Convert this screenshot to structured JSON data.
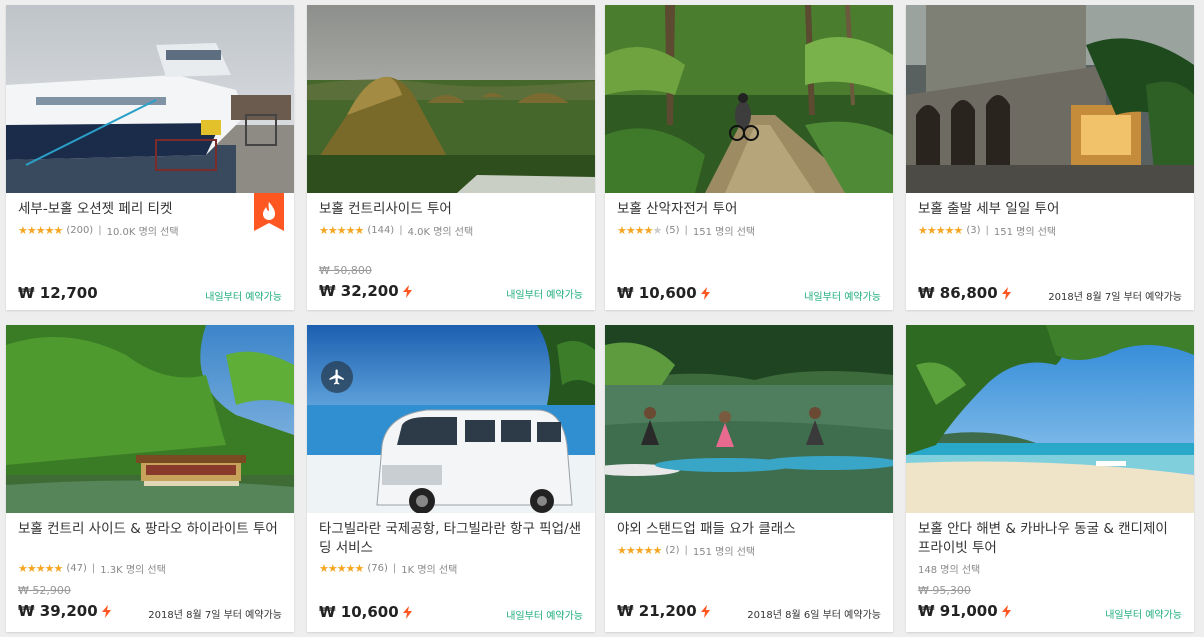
{
  "currency_symbol": "₩",
  "accent_color": "#ff5722",
  "avail_color": "#1fad7e",
  "cards": [
    {
      "title": "세부-보홀 오션젯 페리 티켓",
      "stars": 5,
      "reviews": "(200)",
      "chosen": "10.0K 명의 선택",
      "old_price": "",
      "price": "₩ 12,700",
      "instant": false,
      "avail": "내일부터 예약가능",
      "hot": true
    },
    {
      "title": "보홀 컨트리사이드 투어",
      "stars": 5,
      "reviews": "(144)",
      "chosen": "4.0K 명의 선택",
      "old_price": "₩ 50,800",
      "price": "₩ 32,200",
      "instant": true,
      "avail": "내일부터 예약가능"
    },
    {
      "title": "보홀 산악자전거 투어",
      "stars": 4,
      "reviews": "(5)",
      "chosen": "151 명의 선택",
      "old_price": "",
      "price": "₩ 10,600",
      "instant": true,
      "avail": "내일부터 예약가능"
    },
    {
      "title": "보홀 출발 세부 일일 투어",
      "stars": 5,
      "reviews": "(3)",
      "chosen": "151 명의 선택",
      "old_price": "",
      "price": "₩ 86,800",
      "instant": true,
      "avail": "2018년 8월 7일 부터 예약가능"
    },
    {
      "title": "보홀 컨트리 사이드 & 팡라오 하이라이트 투어",
      "stars": 5,
      "reviews": "(47)",
      "chosen": "1.3K 명의 선택",
      "old_price": "₩ 52,900",
      "price": "₩ 39,200",
      "instant": true,
      "avail": "2018년 8월 7일 부터 예약가능"
    },
    {
      "title": "타그빌라란 국제공항, 타그빌라란 항구 픽업/샌딩 서비스",
      "stars": 5,
      "reviews": "(76)",
      "chosen": "1K 명의 선택",
      "old_price": "",
      "price": "₩ 10,600",
      "instant": true,
      "avail": "내일부터 예약가능"
    },
    {
      "title": "야외 스탠드업 패들 요가 클래스",
      "stars": 5,
      "reviews": "(2)",
      "chosen": "151 명의 선택",
      "old_price": "",
      "price": "₩ 21,200",
      "instant": true,
      "avail": "2018년 8월 6일 부터 예약가능"
    },
    {
      "title": "보홀 안다 해변 & 카바나우 동굴 & 캔디제이 프라이빗 투어",
      "stars": 0,
      "reviews": "",
      "chosen": "148 명의 선택",
      "old_price": "₩ 95,300",
      "price": "₩ 91,000",
      "instant": true,
      "avail": "내일부터 예약가능"
    }
  ]
}
